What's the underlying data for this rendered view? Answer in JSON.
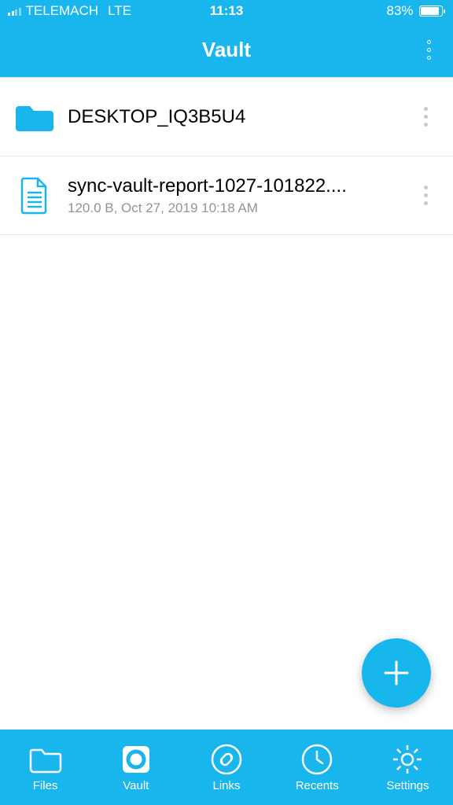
{
  "status": {
    "carrier": "TELEMACH",
    "network": "LTE",
    "time": "11:13",
    "battery_pct": "83%"
  },
  "nav": {
    "title": "Vault"
  },
  "items": [
    {
      "type": "folder",
      "name": "DESKTOP_IQ3B5U4",
      "meta": ""
    },
    {
      "type": "file",
      "name": "sync-vault-report-1027-101822....",
      "meta": "120.0 B, Oct 27, 2019 10:18 AM"
    }
  ],
  "tabs": {
    "files": "Files",
    "vault": "Vault",
    "links": "Links",
    "recents": "Recents",
    "settings": "Settings"
  },
  "colors": {
    "accent": "#19b6ee"
  }
}
